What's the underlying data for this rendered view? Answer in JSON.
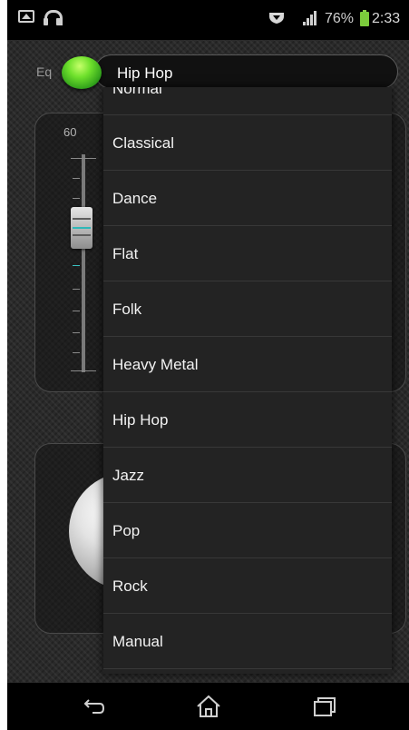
{
  "statusbar": {
    "battery_percent": "76%",
    "time": "2:33",
    "icons": [
      "gallery-icon",
      "headset-icon",
      "shield-icon",
      "signal-icon",
      "battery-icon"
    ],
    "battery_color": "#7ccc3c"
  },
  "equalizer": {
    "label": "Eq",
    "enabled": true,
    "toggle_color": "#5fd62a",
    "selected_preset": "Hip Hop"
  },
  "slider_panel": {
    "scale_label": "60"
  },
  "dropdown": {
    "items": [
      {
        "label": "Normal"
      },
      {
        "label": "Classical"
      },
      {
        "label": "Dance"
      },
      {
        "label": "Flat"
      },
      {
        "label": "Folk"
      },
      {
        "label": "Heavy Metal"
      },
      {
        "label": "Hip Hop"
      },
      {
        "label": "Jazz"
      },
      {
        "label": "Pop"
      },
      {
        "label": "Rock"
      },
      {
        "label": "Manual"
      }
    ]
  },
  "navbar": {
    "buttons": [
      "back-icon",
      "home-icon",
      "recent-apps-icon"
    ]
  }
}
